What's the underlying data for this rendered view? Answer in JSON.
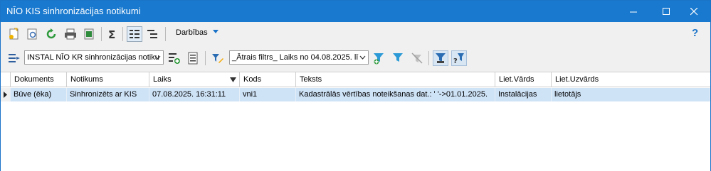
{
  "window": {
    "title": "NĪO KIS sinhronizācijas notikumi",
    "controls": {
      "minimize": "—",
      "maximize": "☐",
      "close": "✕"
    }
  },
  "toolbar": {
    "actions_label": "Darbības",
    "help_label": "?",
    "icons": [
      "new-doc-icon",
      "preview-icon",
      "refresh-icon",
      "print-icon",
      "export-icon",
      "sum-icon",
      "list-view-icon",
      "tree-view-icon",
      "dropdown-icon"
    ]
  },
  "filter_bar": {
    "view_select_value": "INSTAL NĪO KR sinhronizācijas notiku",
    "filter_select_value": "_Ātrais filtrs_ Laiks no 04.08.2025. lī"
  },
  "grid": {
    "columns": [
      "Dokuments",
      "Notikums",
      "Laiks",
      "Kods",
      "Teksts",
      "Liet.Vārds",
      "Liet.Uzvārds"
    ],
    "rows": [
      [
        "Būve (ēka)",
        "Sinhronizēts ar KIS",
        "07.08.2025. 16:31:11",
        "vni1",
        "Kadastrālās vērtības noteikšanas dat.: ' '->01.01.2025.",
        "Instalācijas",
        "lietotājs"
      ]
    ]
  },
  "colors": {
    "titlebar": "#1979cf",
    "selected_row": "#cfe3f7",
    "accent": "#1a73c8"
  }
}
